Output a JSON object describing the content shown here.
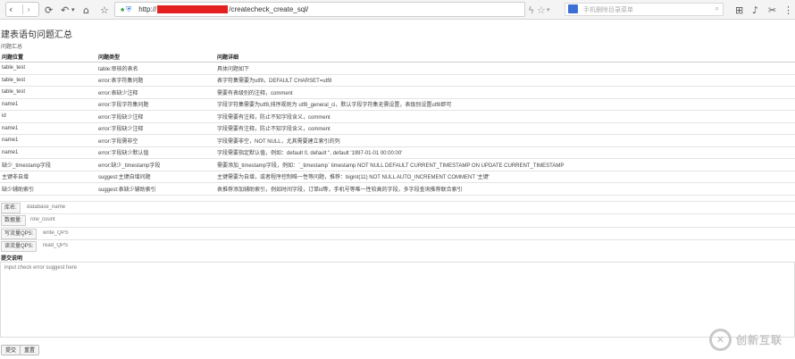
{
  "browser": {
    "url_prefix": "http://",
    "url_suffix": "/createcheck_create_sql/",
    "search_placeholder": "手机删除目录菜单"
  },
  "page": {
    "title": "建表语句问题汇总",
    "subheading": "问题汇总"
  },
  "table": {
    "headers": [
      "问题位置",
      "问题类型",
      "问题详细"
    ],
    "rows": [
      [
        "table_test",
        "table:审核的表名",
        "具体问题如下"
      ],
      [
        "table_test",
        "error:表字符集问题",
        "表字符集需要为utf8，DEFAULT CHARSET=utf8"
      ],
      [
        "table_test",
        "error:表缺少注释",
        "需要有表级别的注释，comment"
      ],
      [
        "name1",
        "error:字段字符集问题",
        "字段字符集需要为utf8,排序规则为 utf8_general_ci，默认字段字符集无需设置，表级别设置utf8即可"
      ],
      [
        "id",
        "error:字段缺少注释",
        "字段需要有注释，防止不知字段含义，comment"
      ],
      [
        "name1",
        "error:字段缺少注释",
        "字段需要有注释，防止不知字段含义，comment"
      ],
      [
        "name1",
        "error:字段需非空",
        "字段需要非空，NOT NULL，尤其需要建立索引的列"
      ],
      [
        "name1",
        "error:字段缺少默认值",
        "字段需要指定默认值，例如：default 0, default '', default '1997-01-01 00:00:00'"
      ],
      [
        "缺少_timestamp字段",
        "error:缺少_timestamp字段",
        "需要添加_timestamp字段，例如：`_timestamp` timestamp NOT NULL DEFAULT CURRENT_TIMESTAMP ON UPDATE CURRENT_TIMESTAMP"
      ],
      [
        "主键非自增",
        "suggest:主键自增问题",
        "主键需要为自增，或者程序控制唯一性等问题，推荐：bigint(11) NOT NULL AUTO_INCREMENT COMMENT '主键'"
      ],
      [
        "缺少辅助索引",
        "suggest:表缺少辅助索引",
        "表推荐添加辅助索引，例如时间字段，订单id等，手机号等唯一性较高的字段，多字段查询推荐联合索引"
      ]
    ]
  },
  "form": {
    "table_label": "库名:",
    "table_placeholder": "database_name",
    "rows_label": "数据量:",
    "rows_placeholder": "row_count",
    "write_label": "写流量QPS:",
    "write_placeholder": "write_QPS",
    "read_label": "读流量QPS:",
    "read_placeholder": "read_QPS",
    "explain_label": "提交说明",
    "explain_placeholder": "input check error suggest here",
    "submit": "提交",
    "reset": "重置"
  },
  "watermark": {
    "text": "创新互联"
  }
}
